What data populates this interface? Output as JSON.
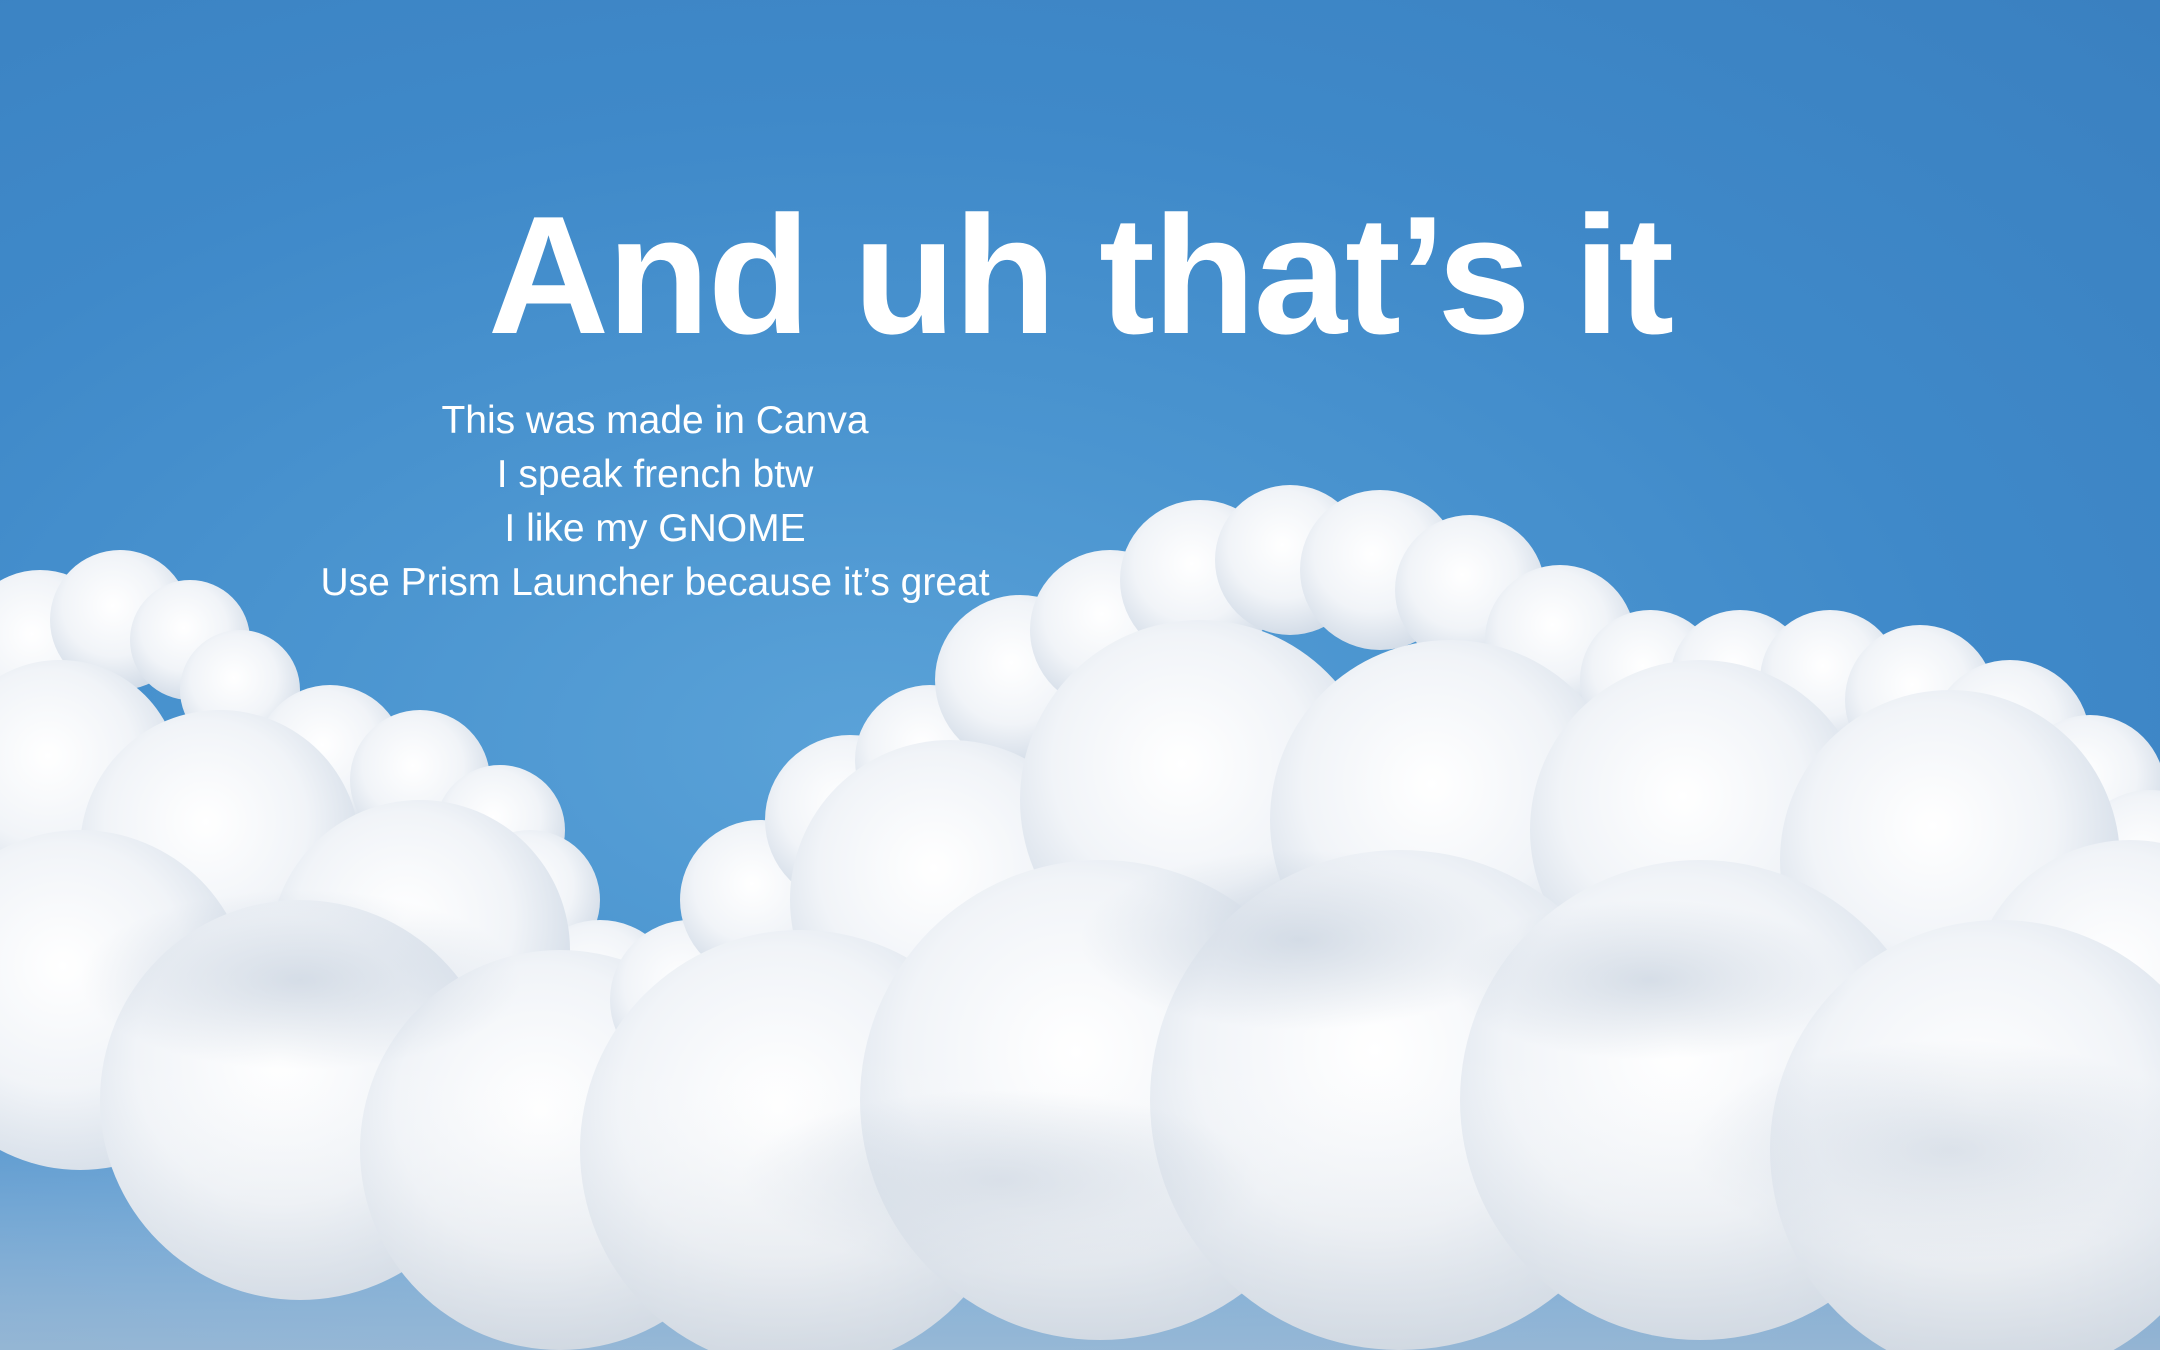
{
  "slide": {
    "title": "And uh that’s it",
    "lines": [
      "This was made in Canva",
      "I speak french btw",
      "I like my GNOME",
      "Use Prism Launcher because it’s great"
    ]
  },
  "colors": {
    "sky_top": "#3a80c0",
    "sky_mid": "#5aa2d8",
    "cloud": "#ffffff",
    "cloud_shadow": "#c9d4e2",
    "text": "#ffffff"
  },
  "background": "blue-sky-with-cumulus-clouds"
}
